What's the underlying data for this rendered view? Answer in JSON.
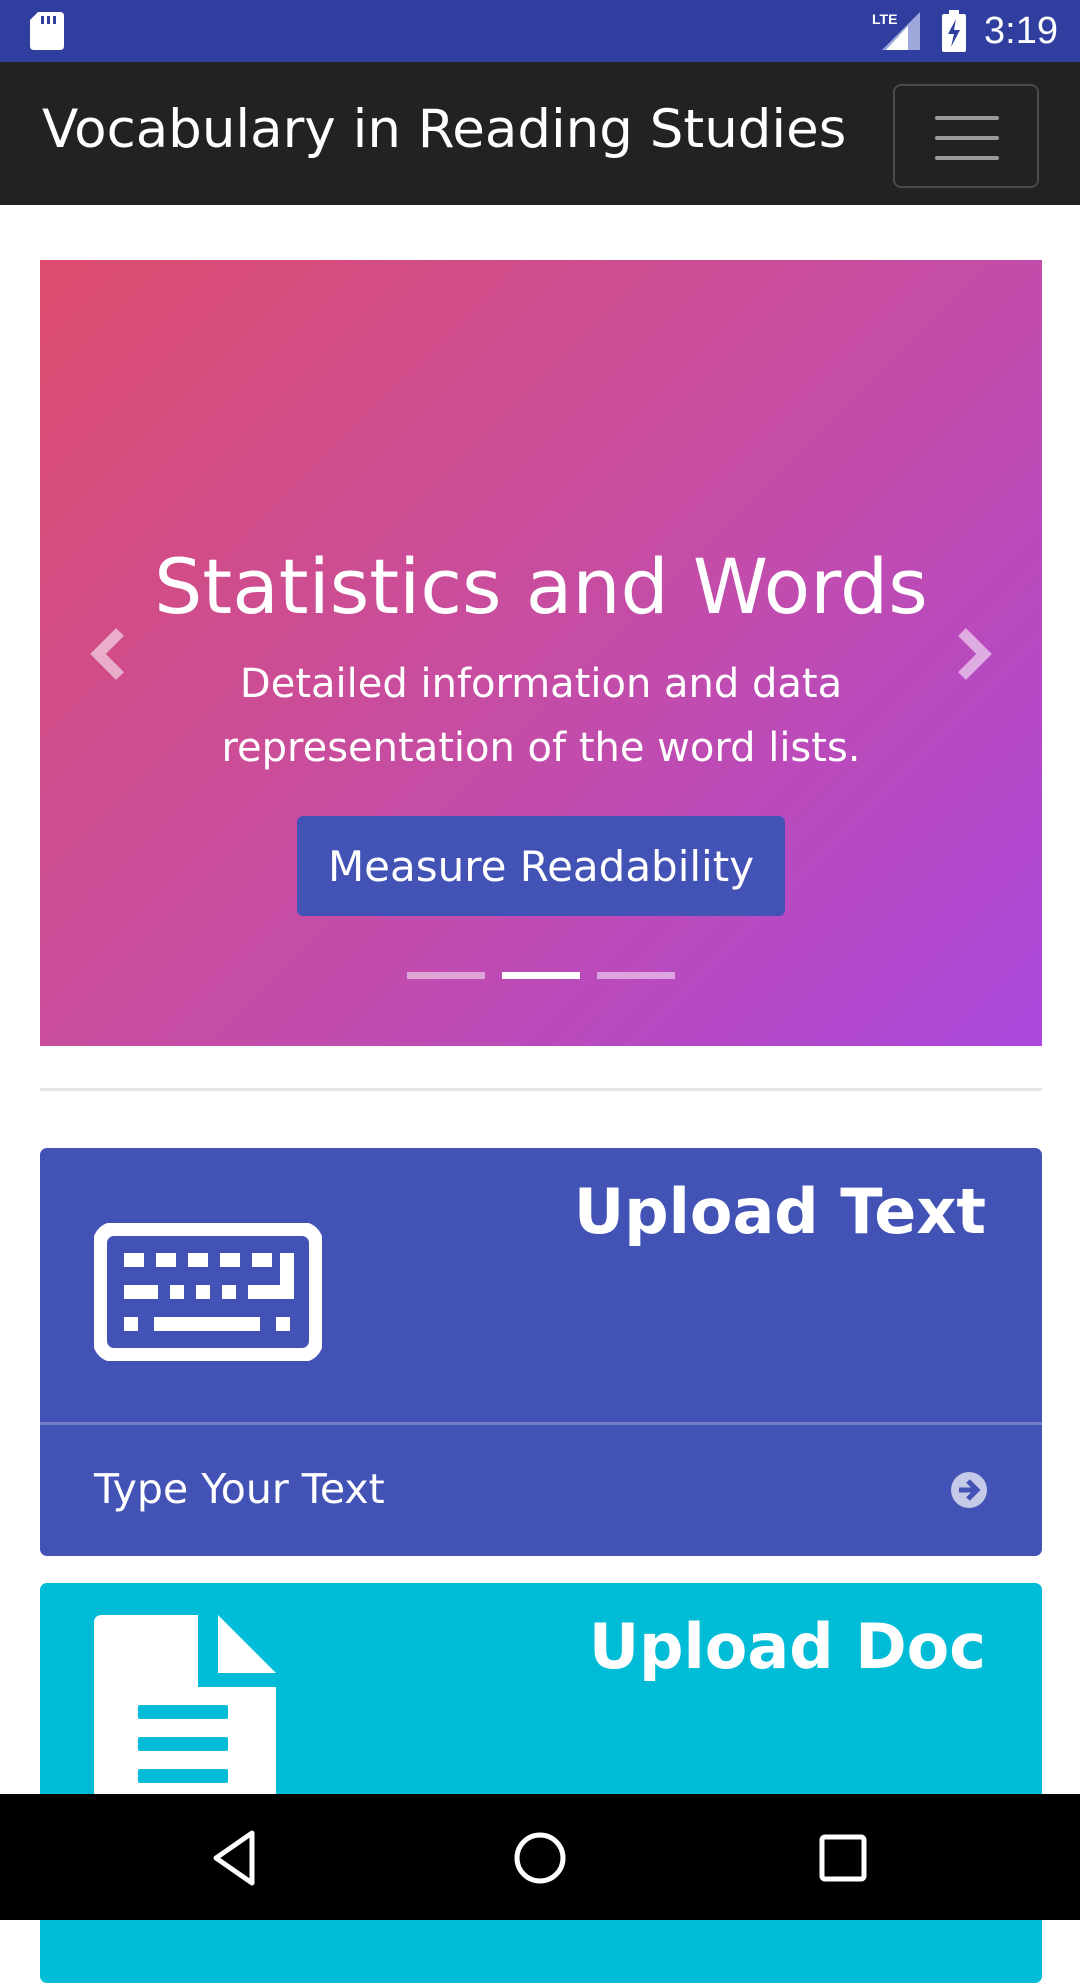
{
  "status_bar": {
    "time": "3:19",
    "network": "LTE",
    "background_color": "#303f9f",
    "icons": [
      "sd-card-icon",
      "lte-signal-icon",
      "battery-charging-icon"
    ]
  },
  "navbar": {
    "brand": "Vocabulary in Reading Studies",
    "menu_icon": "hamburger-icon",
    "background_color": "#222222"
  },
  "carousel": {
    "title": "Statistics and Words",
    "subtitle": "Detailed information and data representation of the word lists.",
    "button_label": "Measure Readability",
    "active_slide": 2,
    "slide_count": 3,
    "prev_icon": "chevron-left-icon",
    "next_icon": "chevron-right-icon",
    "gradient": [
      "#dd4d6e",
      "#ab47dc"
    ],
    "button_color": "#4353b5"
  },
  "cards": [
    {
      "title": "Upload Text",
      "footer_label": "Type Your Text",
      "icon": "keyboard-icon",
      "footer_icon": "arrow-circle-right-icon",
      "color": "#4353b5"
    },
    {
      "title": "Upload Doc",
      "icon": "document-icon",
      "color": "#00bcd6"
    }
  ],
  "system_nav": {
    "buttons": [
      "back-icon",
      "home-icon",
      "recents-icon"
    ]
  }
}
